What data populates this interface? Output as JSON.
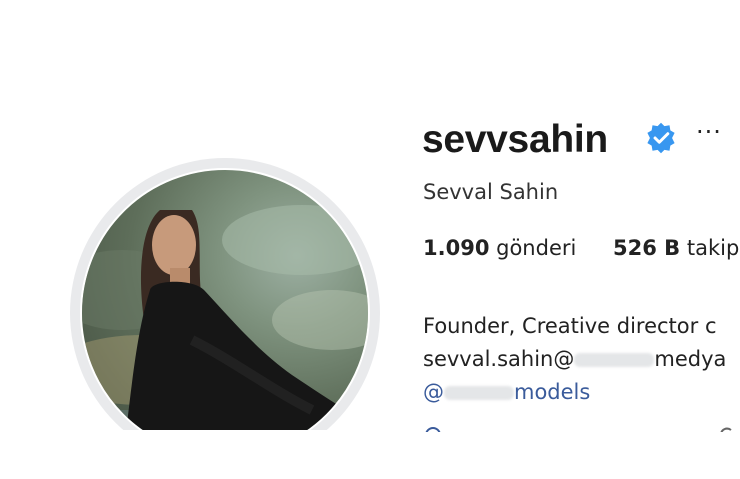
{
  "profile": {
    "username": "sevvsahin",
    "full_name": "Sevval Sahin",
    "more_label": "···",
    "verified_icon": "verified-badge-icon",
    "stats": {
      "posts_count": "1.090",
      "posts_label": "gönderi",
      "followers_count": "526 B",
      "followers_label": "takip"
    },
    "bio": {
      "line1": "Founder, Creative director c",
      "email_start": "sevval.sahin@",
      "email_end": "medya",
      "link_start": "@",
      "link_end": "models"
    },
    "colors": {
      "verified_blue": "#3897f0",
      "link_blue": "#3a5b9b"
    }
  }
}
